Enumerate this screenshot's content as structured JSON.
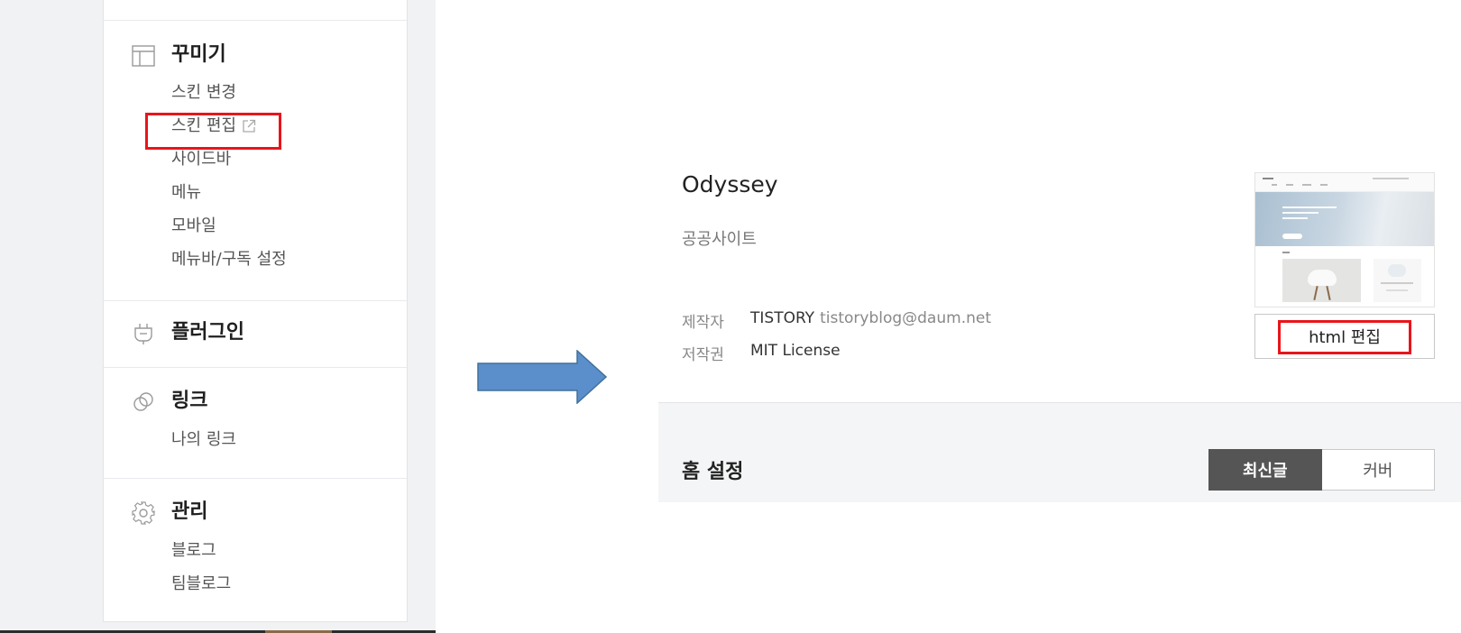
{
  "sidebar": {
    "sections": [
      {
        "title": "꾸미기",
        "icon": "layout-icon",
        "items": [
          "스킨 변경",
          "스킨 편집",
          "사이드바",
          "메뉴",
          "모바일",
          "메뉴바/구독 설정"
        ]
      },
      {
        "title": "플러그인",
        "icon": "plug-icon",
        "items": []
      },
      {
        "title": "링크",
        "icon": "link-icon",
        "items": [
          "나의 링크"
        ]
      },
      {
        "title": "관리",
        "icon": "gear-icon",
        "items": [
          "블로그",
          "팀블로그"
        ]
      }
    ],
    "skin_edit_external_icon": "external-link-icon"
  },
  "arrow": {
    "icon": "right-arrow",
    "color": "#5b8fcb"
  },
  "skin": {
    "name": "Odyssey",
    "description": "공공사이트",
    "author_label": "제작자",
    "author_name": "TISTORY",
    "author_email": "tistoryblog@daum.net",
    "license_label": "저작권",
    "license_value": "MIT License",
    "edit_button_label": "html 편집",
    "thumbnail": "skin-preview-thumbnail"
  },
  "home": {
    "title": "홈 설정",
    "options": [
      "최신글",
      "커버"
    ],
    "selected": "최신글"
  },
  "colors": {
    "highlight": "#e8151b",
    "toggle_active": "#555555",
    "arrow": "#5b8fcb"
  }
}
